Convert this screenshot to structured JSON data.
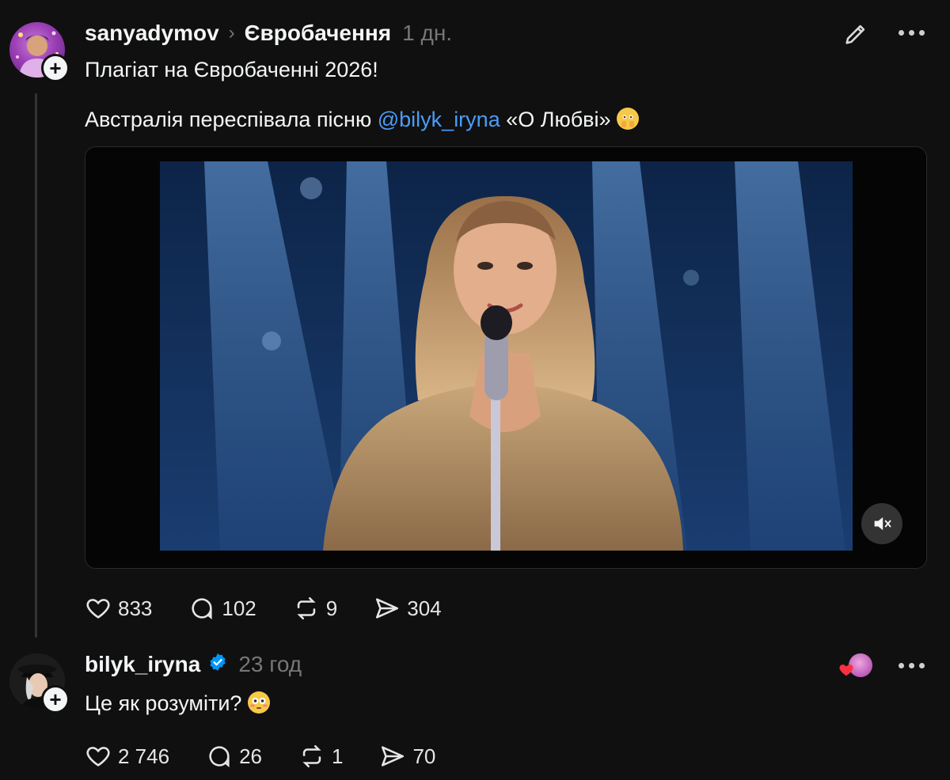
{
  "post": {
    "username": "sanyadymov",
    "community": "Євробачення",
    "time": "1 дн.",
    "line1": "Плагіат на Євробаченні 2026!",
    "line2_prefix": "Австралія переспівала пісню",
    "mention": "@bilyk_iryna",
    "line2_suffix": "«О Любві»",
    "stats": {
      "likes": "833",
      "replies": "102",
      "reposts": "9",
      "shares": "304"
    }
  },
  "reply": {
    "username": "bilyk_iryna",
    "time": "23 год",
    "text": "Це як розуміти?",
    "stats": {
      "likes": "2 746",
      "replies": "26",
      "reposts": "1",
      "shares": "70"
    }
  },
  "icons": {
    "edit": "pencil-icon",
    "more": "more-dots-icon",
    "like": "heart-icon",
    "reply": "comment-bubble-icon",
    "repost": "repost-arrows-icon",
    "share": "send-icon",
    "mute": "speaker-muted-icon",
    "verified": "verified-badge-icon"
  },
  "colors": {
    "background": "#101010",
    "mention": "#4a9df8",
    "verified": "#0095f6",
    "muted_text": "#777777"
  }
}
